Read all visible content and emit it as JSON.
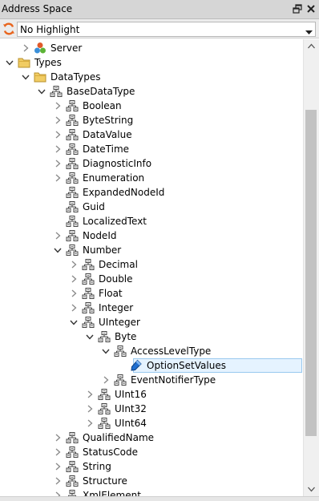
{
  "panel": {
    "title": "Address Space"
  },
  "toolbar": {
    "highlight_value": "No Highlight"
  },
  "icons": {
    "float": "float-window-icon",
    "close": "close-icon",
    "refresh": "refresh-icon",
    "dropdown": "dropdown-arrow-icon",
    "server": "server-icon",
    "folder": "folder-icon",
    "datatype": "datatype-icon",
    "variable": "variable-icon",
    "expand": "chevron-right-icon",
    "collapse": "chevron-down-icon"
  },
  "colors": {
    "selection_fill": "#e5f3ff",
    "selection_border": "#99c9ef",
    "folder": "#e8c052",
    "refresh": "#e8651e"
  },
  "tree": [
    {
      "label": "Server",
      "depth": 1,
      "expander": "collapsed",
      "icon": "server"
    },
    {
      "label": "Types",
      "depth": 0,
      "expander": "expanded",
      "icon": "folder"
    },
    {
      "label": "DataTypes",
      "depth": 1,
      "expander": "expanded",
      "icon": "folder"
    },
    {
      "label": "BaseDataType",
      "depth": 2,
      "expander": "expanded",
      "icon": "datatype"
    },
    {
      "label": "Boolean",
      "depth": 3,
      "expander": "collapsed",
      "icon": "datatype"
    },
    {
      "label": "ByteString",
      "depth": 3,
      "expander": "collapsed",
      "icon": "datatype"
    },
    {
      "label": "DataValue",
      "depth": 3,
      "expander": "collapsed",
      "icon": "datatype"
    },
    {
      "label": "DateTime",
      "depth": 3,
      "expander": "collapsed",
      "icon": "datatype"
    },
    {
      "label": "DiagnosticInfo",
      "depth": 3,
      "expander": "collapsed",
      "icon": "datatype"
    },
    {
      "label": "Enumeration",
      "depth": 3,
      "expander": "collapsed",
      "icon": "datatype"
    },
    {
      "label": "ExpandedNodeId",
      "depth": 3,
      "expander": "none",
      "icon": "datatype"
    },
    {
      "label": "Guid",
      "depth": 3,
      "expander": "none",
      "icon": "datatype"
    },
    {
      "label": "LocalizedText",
      "depth": 3,
      "expander": "none",
      "icon": "datatype"
    },
    {
      "label": "NodeId",
      "depth": 3,
      "expander": "collapsed",
      "icon": "datatype"
    },
    {
      "label": "Number",
      "depth": 3,
      "expander": "expanded",
      "icon": "datatype"
    },
    {
      "label": "Decimal",
      "depth": 4,
      "expander": "collapsed",
      "icon": "datatype"
    },
    {
      "label": "Double",
      "depth": 4,
      "expander": "collapsed",
      "icon": "datatype"
    },
    {
      "label": "Float",
      "depth": 4,
      "expander": "collapsed",
      "icon": "datatype"
    },
    {
      "label": "Integer",
      "depth": 4,
      "expander": "collapsed",
      "icon": "datatype"
    },
    {
      "label": "UInteger",
      "depth": 4,
      "expander": "expanded",
      "icon": "datatype"
    },
    {
      "label": "Byte",
      "depth": 5,
      "expander": "expanded",
      "icon": "datatype"
    },
    {
      "label": "AccessLevelType",
      "depth": 6,
      "expander": "expanded",
      "icon": "datatype"
    },
    {
      "label": "OptionSetValues",
      "depth": 7,
      "expander": "none",
      "icon": "variable",
      "selected": true
    },
    {
      "label": "EventNotifierType",
      "depth": 6,
      "expander": "collapsed",
      "icon": "datatype"
    },
    {
      "label": "UInt16",
      "depth": 5,
      "expander": "collapsed",
      "icon": "datatype"
    },
    {
      "label": "UInt32",
      "depth": 5,
      "expander": "collapsed",
      "icon": "datatype"
    },
    {
      "label": "UInt64",
      "depth": 5,
      "expander": "collapsed",
      "icon": "datatype"
    },
    {
      "label": "QualifiedName",
      "depth": 3,
      "expander": "collapsed",
      "icon": "datatype"
    },
    {
      "label": "StatusCode",
      "depth": 3,
      "expander": "collapsed",
      "icon": "datatype"
    },
    {
      "label": "String",
      "depth": 3,
      "expander": "collapsed",
      "icon": "datatype"
    },
    {
      "label": "Structure",
      "depth": 3,
      "expander": "collapsed",
      "icon": "datatype"
    },
    {
      "label": "XmlElement",
      "depth": 3,
      "expander": "collapsed",
      "icon": "datatype"
    }
  ]
}
